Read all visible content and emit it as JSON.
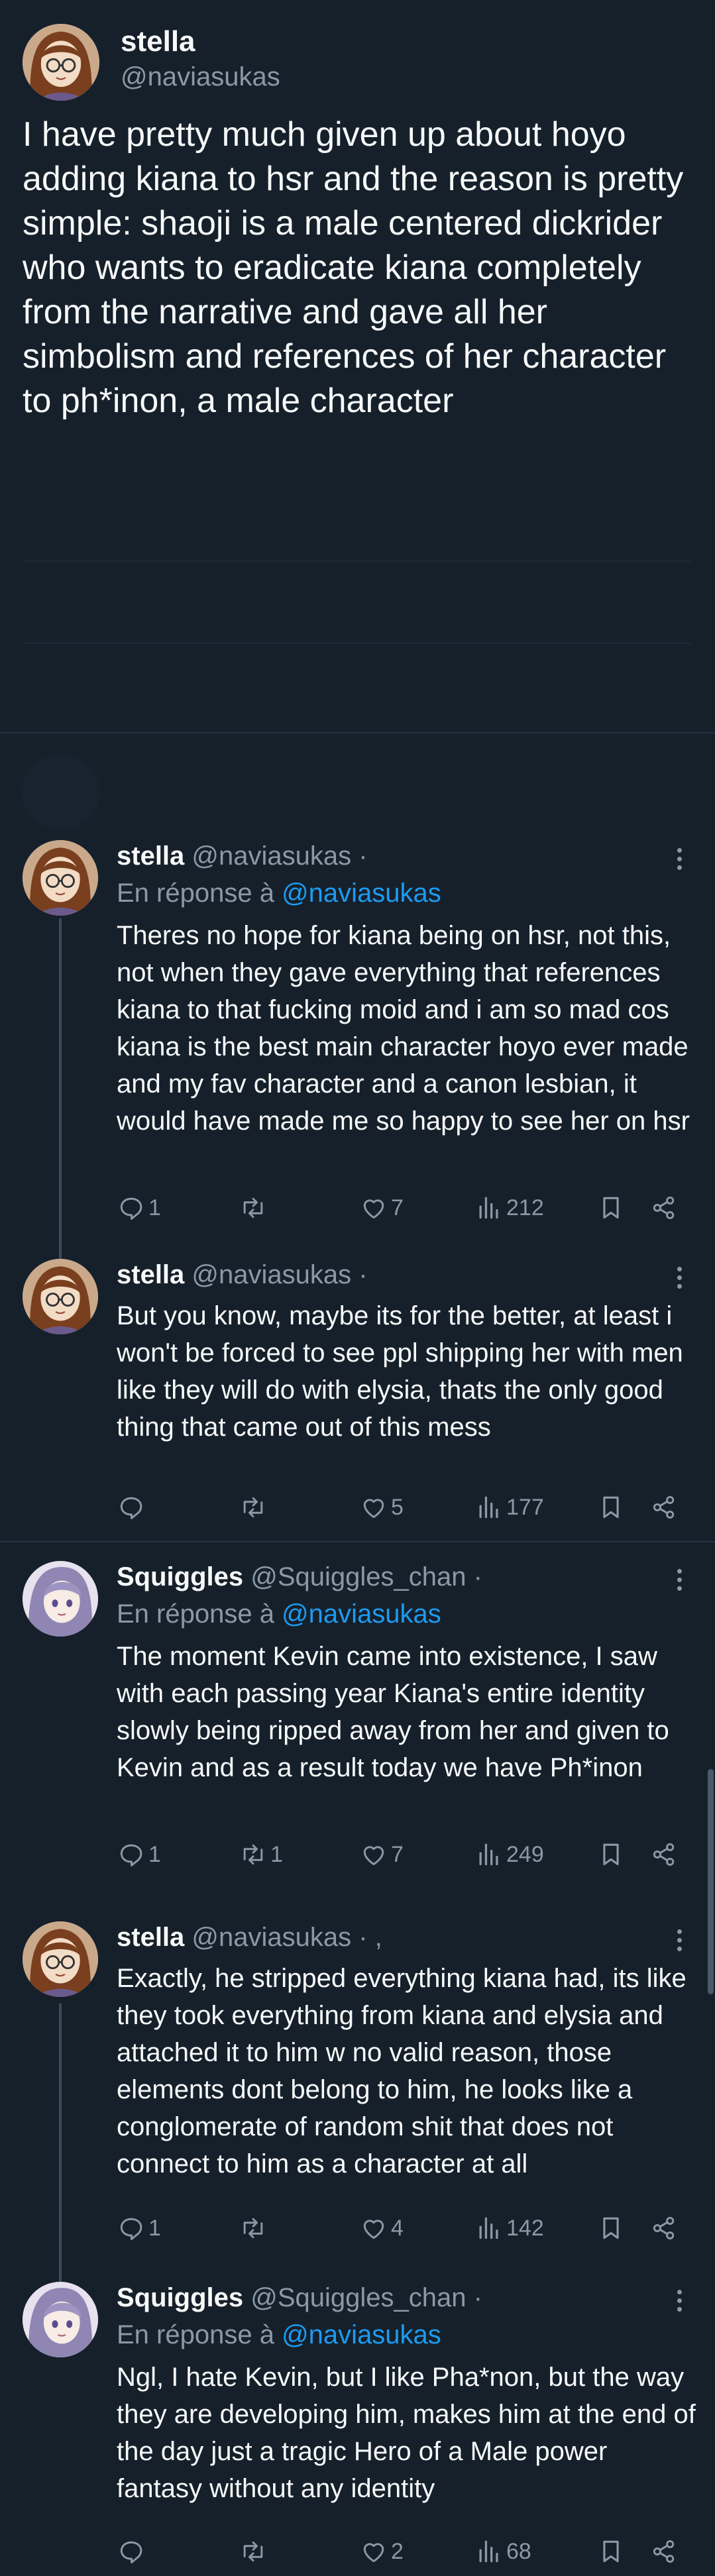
{
  "main_post": {
    "name": "stella",
    "handle": "@naviasukas",
    "text": "I have pretty much given up about hoyo adding kiana to hsr and the reason is pretty simple: shaoji is a male centered dickrider who wants to eradicate kiana completely from the narrative and gave all her simbolism and references of her character to ph*inon, a male character"
  },
  "replies": [
    {
      "name": "stella",
      "handle": "@naviasukas ·",
      "reply_to_prefix": "En réponse à",
      "reply_to": "@naviasukas",
      "text": "Theres no hope for kiana being on hsr, not this, not when they gave everything that references kiana to that fucking moid and i am so mad cos kiana is the best main character hoyo ever made and my fav character and a canon lesbian, it would have made me so happy to see her on hsr",
      "replies": "1",
      "reposts": "",
      "likes": "7",
      "views": "212"
    },
    {
      "name": "stella",
      "handle": "@naviasukas ·",
      "text": "But you know, maybe its for the better, at least i won't be forced to see ppl shipping her with men like they will do with elysia, thats the only good thing that came out of this mess",
      "replies": "",
      "reposts": "",
      "likes": "5",
      "views": "177"
    },
    {
      "name": "Squiggles",
      "handle": "@Squiggles_chan ·",
      "reply_to_prefix": "En réponse à",
      "reply_to": "@naviasukas",
      "text": "The moment Kevin came into existence, I saw with each passing year Kiana's entire identity slowly being ripped away from her and given to Kevin and as a result today we have Ph*inon",
      "replies": "1",
      "reposts": "1",
      "likes": "7",
      "views": "249"
    },
    {
      "name": "stella",
      "handle": "@naviasukas · ,",
      "text": "Exactly, he stripped everything kiana had, its like they took everything from kiana and elysia and attached it to him w no valid reason, those elements dont belong to him, he looks like a conglomerate of random shit that does not connect to him as a character at all",
      "replies": "1",
      "reposts": "",
      "likes": "4",
      "views": "142"
    },
    {
      "name": "Squiggles",
      "handle": "@Squiggles_chan ·",
      "reply_to_prefix": "En réponse à",
      "reply_to": "@naviasukas",
      "text": "Ngl, I hate Kevin, but I like Pha*non, but the way they are developing him, makes him at the end of the day just a tragic Hero of a Male power fantasy without any identity",
      "replies": "",
      "reposts": "",
      "likes": "2",
      "views": "68"
    }
  ],
  "icons": {
    "reply": "speech-bubble-icon",
    "repost": "repost-arrows-icon",
    "like": "heart-icon",
    "views": "bar-chart-icon",
    "bookmark": "bookmark-icon",
    "share": "share-icon",
    "more": "more-vertical-icon"
  },
  "colors": {
    "background": "#15202b",
    "text": "#f7f9f9",
    "muted": "#8b98a5",
    "link": "#1d9bf0"
  }
}
